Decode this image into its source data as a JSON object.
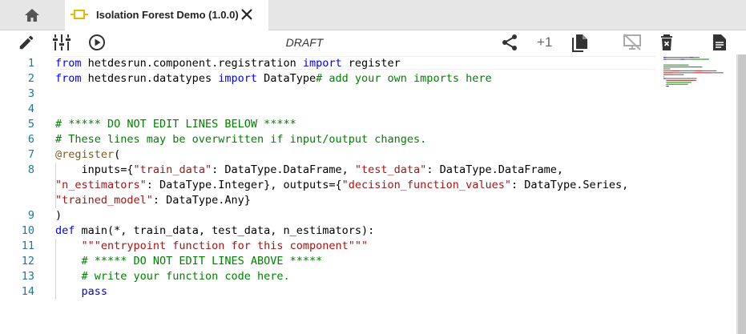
{
  "tab": {
    "title": "Isolation Forest Demo (1.0.0)"
  },
  "toolbar": {
    "status": "DRAFT",
    "plus_one": "+1"
  },
  "colors": {
    "keyword": "#0000ff",
    "comment": "#008000",
    "string": "#a31515",
    "decorator": "#795e26",
    "line_number": "#237893"
  },
  "icons": {
    "home": "home-icon",
    "component": "component-icon",
    "close": "close-icon",
    "edit": "pencil-icon",
    "io": "tune-icon",
    "run": "play-icon",
    "share": "share-icon",
    "copy": "copy-icon",
    "unpublish": "desktop-off-icon",
    "delete": "trash-icon",
    "docs": "document-icon"
  },
  "code": {
    "lines": [
      {
        "n": "1",
        "tokens": [
          {
            "t": "from",
            "c": "kw"
          },
          {
            "t": " hetdesrun.component.registration ",
            "c": ""
          },
          {
            "t": "import",
            "c": "kw"
          },
          {
            "t": " register",
            "c": ""
          }
        ]
      },
      {
        "n": "2",
        "tokens": [
          {
            "t": "from",
            "c": "kw"
          },
          {
            "t": " hetdesrun.datatypes ",
            "c": ""
          },
          {
            "t": "import",
            "c": "kw"
          },
          {
            "t": " DataType",
            "c": ""
          },
          {
            "t": "# add your own imports here",
            "c": "cm"
          }
        ]
      },
      {
        "n": "3",
        "tokens": []
      },
      {
        "n": "4",
        "tokens": []
      },
      {
        "n": "5",
        "tokens": [
          {
            "t": "# ***** DO NOT EDIT LINES BELOW *****",
            "c": "cm"
          }
        ]
      },
      {
        "n": "6",
        "tokens": [
          {
            "t": "# These lines may be overwritten if input/output changes.",
            "c": "cm"
          }
        ]
      },
      {
        "n": "7",
        "tokens": [
          {
            "t": "@register",
            "c": "dc"
          },
          {
            "t": "(",
            "c": ""
          }
        ]
      },
      {
        "n": "8",
        "tokens": [
          {
            "t": "    inputs={",
            "c": ""
          },
          {
            "t": "\"train_data\"",
            "c": "st"
          },
          {
            "t": ": DataType.DataFrame, ",
            "c": ""
          },
          {
            "t": "\"test_data\"",
            "c": "st"
          },
          {
            "t": ": DataType.DataFrame,",
            "c": ""
          }
        ]
      },
      {
        "n": "",
        "tokens": [
          {
            "t": "\"n_estimators\"",
            "c": "st"
          },
          {
            "t": ": DataType.Integer}, outputs={",
            "c": ""
          },
          {
            "t": "\"decision_function_values\"",
            "c": "st"
          },
          {
            "t": ": DataType.Series,",
            "c": ""
          }
        ]
      },
      {
        "n": "",
        "tokens": [
          {
            "t": "\"trained_model\"",
            "c": "st"
          },
          {
            "t": ": DataType.Any}",
            "c": ""
          }
        ]
      },
      {
        "n": "9",
        "tokens": [
          {
            "t": ")",
            "c": ""
          }
        ]
      },
      {
        "n": "10",
        "tokens": [
          {
            "t": "def",
            "c": "kw"
          },
          {
            "t": " main(*, train_data, test_data, n_estimators):",
            "c": ""
          }
        ]
      },
      {
        "n": "11",
        "tokens": [
          {
            "t": "    ",
            "c": ""
          },
          {
            "t": "\"\"\"entrypoint function for this component\"\"\"",
            "c": "st"
          }
        ]
      },
      {
        "n": "12",
        "tokens": [
          {
            "t": "    ",
            "c": ""
          },
          {
            "t": "# ***** DO NOT EDIT LINES ABOVE *****",
            "c": "cm"
          }
        ]
      },
      {
        "n": "13",
        "tokens": [
          {
            "t": "    ",
            "c": ""
          },
          {
            "t": "# write your function code here.",
            "c": "cm"
          }
        ]
      },
      {
        "n": "14",
        "tokens": [
          {
            "t": "    ",
            "c": ""
          },
          {
            "t": "pass",
            "c": "kw"
          }
        ]
      }
    ]
  }
}
